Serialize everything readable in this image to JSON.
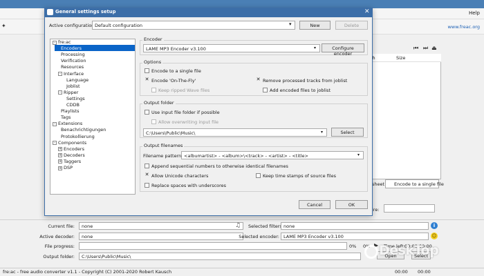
{
  "main": {
    "menu_help": "Help",
    "site_link": "www.freac.org",
    "columns": {
      "length": "th",
      "size": "Size"
    },
    "sheet_label": "sheet",
    "single_file_label": "Encode to a single file",
    "profile_label": "ire:",
    "current_file_label": "Current file:",
    "current_file_value": "none",
    "active_decoder_label": "Active decoder:",
    "active_decoder_value": "none",
    "file_progress_label": "File progress:",
    "output_folder_label": "Output folder:",
    "output_folder_value": "C:\\Users\\Public\\Music\\",
    "selected_filters_label": "Selected filters:",
    "selected_filters_value": "none",
    "selected_encoder_label": "Selected encoder:",
    "selected_encoder_value": "LAME MP3 Encoder v3.100",
    "file_pct": "0%",
    "total_pct": "0%",
    "time_left_label": "Time left:",
    "time_left_value": "00:00",
    "time_other_value": "00:00",
    "open_button": "Open",
    "select_button": "Select",
    "status_text": "fre:ac - free audio converter v1.1 - Copyright (C) 2001-2020 Robert Kausch",
    "status_time1": "00:00",
    "status_time2": "00:00"
  },
  "watermark": "DeskTop",
  "dialog": {
    "title": "General settings setup",
    "active_config_label": "Active configuration:",
    "active_config_value": "Default configuration",
    "new_button": "New",
    "delete_button": "Delete",
    "tree": [
      {
        "label": "fre:ac",
        "indent": 0,
        "toggle": "-"
      },
      {
        "label": "Encoders",
        "indent": 1,
        "selected": true
      },
      {
        "label": "Processing",
        "indent": 1
      },
      {
        "label": "Verification",
        "indent": 1
      },
      {
        "label": "Resources",
        "indent": 1
      },
      {
        "label": "Interface",
        "indent": 1,
        "toggle": "-"
      },
      {
        "label": "Language",
        "indent": 2
      },
      {
        "label": "Joblist",
        "indent": 2
      },
      {
        "label": "Ripper",
        "indent": 1,
        "toggle": "-"
      },
      {
        "label": "Settings",
        "indent": 2
      },
      {
        "label": "CDDB",
        "indent": 2
      },
      {
        "label": "Playlists",
        "indent": 1
      },
      {
        "label": "Tags",
        "indent": 1
      },
      {
        "label": "Extensions",
        "indent": 0,
        "toggle": "-"
      },
      {
        "label": "Benachrichtigungen",
        "indent": 1
      },
      {
        "label": "Protokollierung",
        "indent": 1
      },
      {
        "label": "Components",
        "indent": 0,
        "toggle": "-"
      },
      {
        "label": "Encoders",
        "indent": 1,
        "toggle": "+"
      },
      {
        "label": "Decoders",
        "indent": 1,
        "toggle": "+"
      },
      {
        "label": "Taggers",
        "indent": 1,
        "toggle": "+"
      },
      {
        "label": "DSP",
        "indent": 1,
        "toggle": "+"
      }
    ],
    "encoder": {
      "group_title": "Encoder",
      "value": "LAME MP3 Encoder v3.100",
      "configure_button": "Configure encoder"
    },
    "options": {
      "group_title": "Options",
      "single_file": "Encode to a single file",
      "on_the_fly": "Encode 'On-The-Fly'",
      "keep_wave": "Keep ripped Wave files",
      "remove_processed": "Remove processed tracks from joblist",
      "add_encoded": "Add encoded files to joblist"
    },
    "output_folder": {
      "group_title": "Output folder",
      "use_input": "Use input file folder if possible",
      "allow_overwrite": "Allow overwriting input file",
      "path": "C:\\Users\\Public\\Music\\",
      "select_button": "Select"
    },
    "output_filenames": {
      "group_title": "Output filenames",
      "pattern_label": "Filename pattern:",
      "pattern_value": "<albumartist> - <album>\\<track> - <artist> - <title>",
      "append_numbers": "Append sequential numbers to otherwise identical filenames",
      "allow_unicode": "Allow Unicode characters",
      "keep_timestamps": "Keep time stamps of source files",
      "replace_spaces": "Replace spaces with underscores"
    },
    "cancel_button": "Cancel",
    "ok_button": "OK"
  },
  "colors": {
    "title_bar": "#3c6ea8",
    "selection": "#0a64c8",
    "link": "#1a5fb4"
  }
}
